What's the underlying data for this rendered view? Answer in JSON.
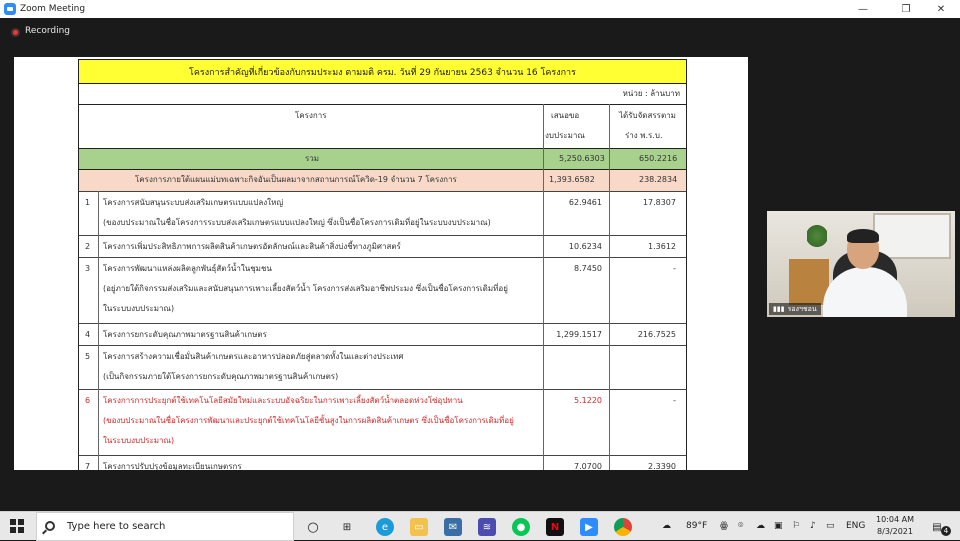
{
  "window": {
    "title": "Zoom Meeting",
    "recording_label": "Recording"
  },
  "controls": {
    "minimize": "—",
    "restore": "❐",
    "close": "✕"
  },
  "table": {
    "title": "โครงการสำคัญที่เกี่ยวข้องกับกรมประมง ตามมติ ครม. วันที่ 29 กันยายน 2563 จำนวน  16 โครงการ",
    "unit": "หน่วย : ล้านบาท",
    "headers": {
      "project": "โครงการ",
      "budget_proposed_l1": "เสนอขอ",
      "budget_proposed_l2": "งบประมาณ",
      "budget_received_l1": "ได้รับจัดสรรตาม",
      "budget_received_l2": "ร่าง พ.ร.บ."
    },
    "total": {
      "label": "รวม",
      "proposed": "5,250.6303",
      "received": "650.2216"
    },
    "group": {
      "label": "โครงการภายใต้แผนแม่บทเฉพาะกิจอันเป็นผลมาจากสถานการณ์โควิด-19 จำนวน 7 โครงการ",
      "proposed": "1,393.6582",
      "received": "238.2834"
    },
    "rows": [
      {
        "no": "1",
        "lines": [
          "โครงการสนับสนุนระบบส่งเสริมเกษตรแบบแปลงใหญ่",
          "(ของบประมาณในชื่อโครงการระบบส่งเสริมเกษตรแบบแปลงใหญ่ ซึ่งเป็นชื่อโครงการเดิมที่อยู่ในระบบงบประมาณ)"
        ],
        "proposed": "62.9461",
        "received": "17.8307",
        "red": false
      },
      {
        "no": "2",
        "lines": [
          "โครงการเพิ่มประสิทธิภาพการผลิตสินค้าเกษตรอัตลักษณ์และสินค้าสิ่งบ่งชี้ทางภูมิศาสตร์"
        ],
        "proposed": "10.6234",
        "received": "1.3612",
        "red": false
      },
      {
        "no": "3",
        "lines": [
          "โครงการพัฒนาแหล่งผลิตลูกพันธุ์สัตว์น้ำในชุมชน",
          "(อยู่ภายใต้กิจกรรมส่งเสริมและสนับสนุนการเพาะเลี้ยงสัตว์น้ำ โครงการส่งเสริมอาชีพประมง ซึ่งเป็นชื่อโครงการเดิมที่อยู่",
          "ในระบบงบประมาณ)"
        ],
        "proposed": "8.7450",
        "received": "-",
        "red": false
      },
      {
        "no": "4",
        "lines": [
          "โครงการยกระดับคุณภาพมาตรฐานสินค้าเกษตร"
        ],
        "proposed": "1,299.1517",
        "received": "216.7525",
        "red": false
      },
      {
        "no": "5",
        "lines": [
          "โครงการสร้างความเชื่อมั่นสินค้าเกษตรและอาหารปลอดภัยสู่ตลาดทั้งในและต่างประเทศ",
          "(เป็นกิจกรรมภายใต้โครงการยกระดับคุณภาพมาตรฐานสินค้าเกษตร)"
        ],
        "proposed": "",
        "received": "",
        "red": false
      },
      {
        "no": "6",
        "lines": [
          "โครงการการประยุกต์ใช้เทคโนโลยีสมัยใหม่และระบบอัจฉริยะในการเพาะเลี้ยงสัตว์น้ำตลอดห่วงโซ่อุปทาน",
          "(ของบประมาณในชื่อโครงการพัฒนาและประยุกต์ใช้เทคโนโลยีชั้นสูงในการผลิตสินค้าเกษตร ซึ่งเป็นชื่อโครงการเดิมที่อยู่",
          "ในระบบงบประมาณ)"
        ],
        "proposed": "5.1220",
        "received": "-",
        "red": true
      },
      {
        "no": "7",
        "lines": [
          "โครงการปรับปรุงข้อมูลทะเบียนเกษตรกร"
        ],
        "proposed": "7.0700",
        "received": "2.3390",
        "red": false
      }
    ]
  },
  "video": {
    "participant": "รองฯชอน"
  },
  "taskbar": {
    "search_placeholder": "Type here to search",
    "weather": "89°F",
    "language": "ENG",
    "time": "10:04 AM",
    "date": "8/3/2021",
    "notifications": "4"
  }
}
